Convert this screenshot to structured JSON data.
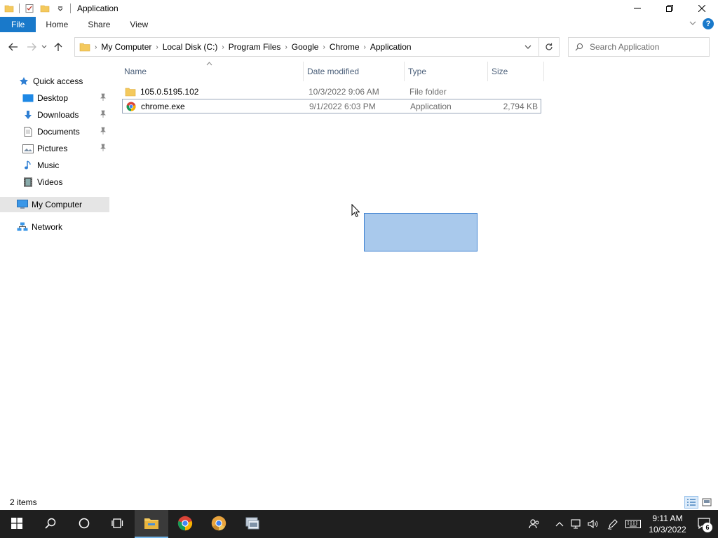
{
  "window": {
    "title": "Application"
  },
  "ribbon": {
    "tabs": [
      "File",
      "Home",
      "Share",
      "View"
    ]
  },
  "address": {
    "crumbs": [
      "My Computer",
      "Local Disk (C:)",
      "Program Files",
      "Google",
      "Chrome",
      "Application"
    ]
  },
  "search": {
    "placeholder": "Search Application"
  },
  "nav": {
    "quick_access": "Quick access",
    "items": [
      "Desktop",
      "Downloads",
      "Documents",
      "Pictures",
      "Music",
      "Videos"
    ],
    "my_computer": "My Computer",
    "network": "Network"
  },
  "columns": {
    "name": "Name",
    "date": "Date modified",
    "type": "Type",
    "size": "Size"
  },
  "files": [
    {
      "name": "105.0.5195.102",
      "date": "10/3/2022 9:06 AM",
      "type": "File folder",
      "size": ""
    },
    {
      "name": "chrome.exe",
      "date": "9/1/2022 6:03 PM",
      "type": "Application",
      "size": "2,794 KB"
    }
  ],
  "status": {
    "count": "2 items"
  },
  "taskbar": {
    "time": "9:11 AM",
    "date": "10/3/2022",
    "notifications": "6"
  },
  "colors": {
    "accent": "#1979ca",
    "selection": "#a9c9ec",
    "taskbar": "#1f1f1f"
  }
}
